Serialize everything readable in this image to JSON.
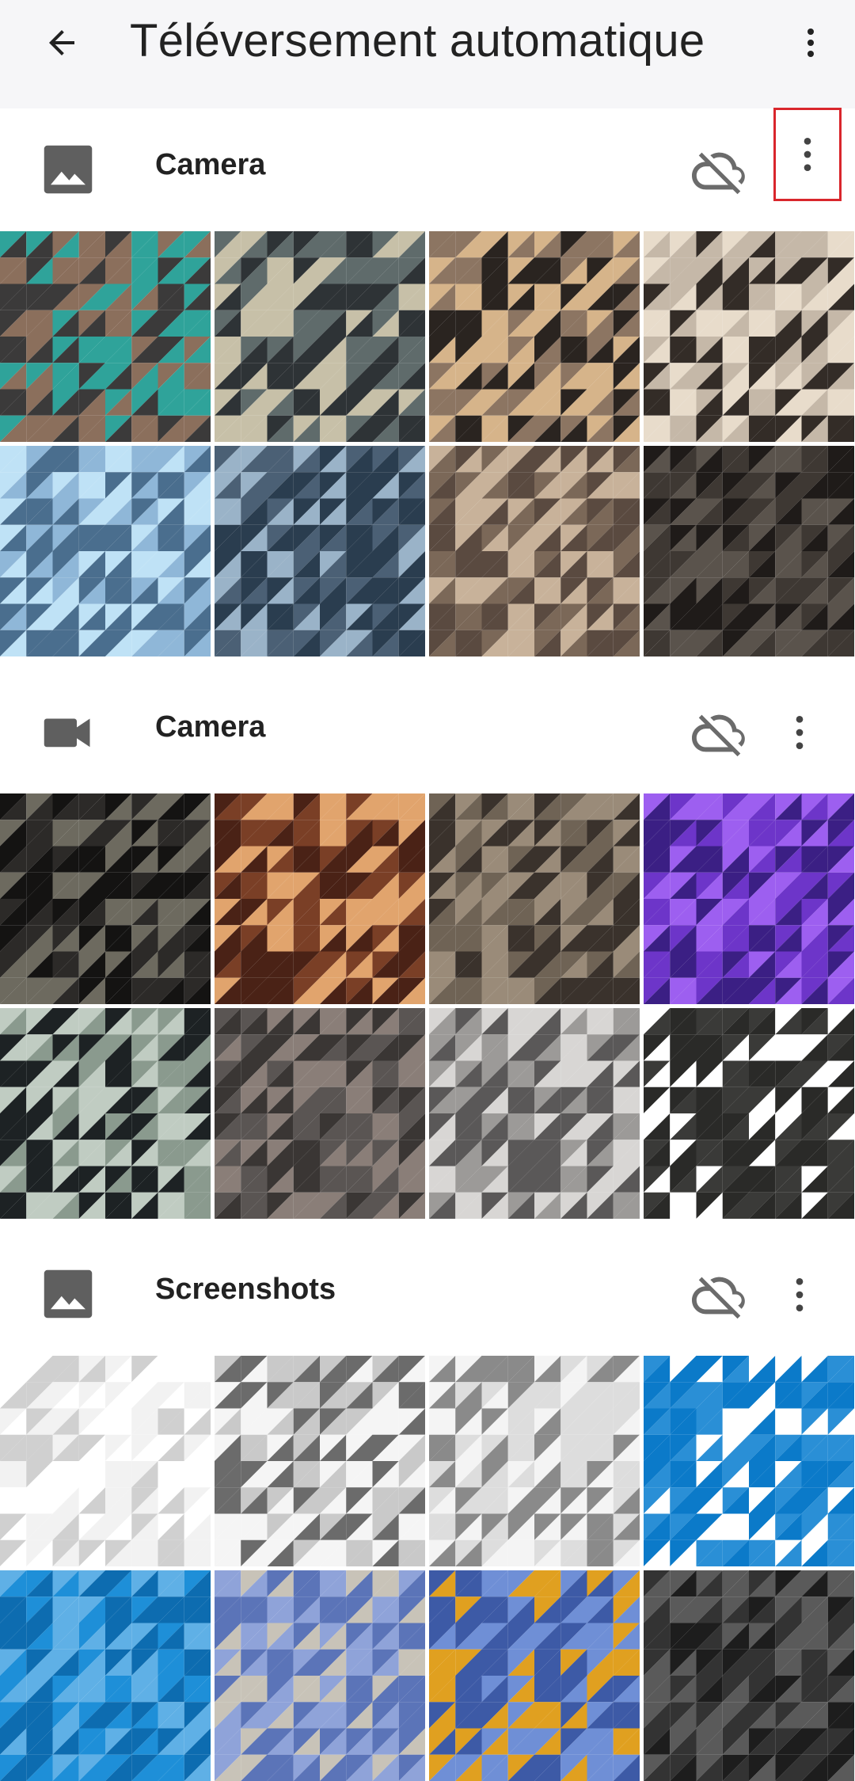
{
  "appbar": {
    "title": "Téléversement automatique",
    "back_icon": "arrow-back-icon",
    "more_icon": "more-vert-icon"
  },
  "sections": [
    {
      "label": "Camera",
      "type_icon": "image-icon",
      "status_icon": "cloud-off-icon",
      "more_icon": "more-vert-icon",
      "highlighted": true,
      "tiles": [
        [
          "#8b6f5c",
          "#3b3a3a",
          "#2fa39a"
        ],
        [
          "#5f6b6b",
          "#c7c0a8",
          "#2e3336"
        ],
        [
          "#8c7562",
          "#d6b48a",
          "#2a2420"
        ],
        [
          "#c5b8a8",
          "#e8dccb",
          "#332c27"
        ],
        [
          "#8fb7d8",
          "#4a6e8e",
          "#bfe2f6"
        ],
        [
          "#4b6075",
          "#2a3d4f",
          "#9ab3c8"
        ],
        [
          "#5a4a40",
          "#c8b29a",
          "#7b6858"
        ],
        [
          "#3e3833",
          "#5a534c",
          "#1f1b19"
        ]
      ]
    },
    {
      "label": "Camera",
      "type_icon": "video-camera-icon",
      "status_icon": "cloud-off-icon",
      "more_icon": "more-vert-icon",
      "highlighted": false,
      "tiles": [
        [
          "#2c2a28",
          "#6d6a5f",
          "#141312"
        ],
        [
          "#7a3f26",
          "#e1a46d",
          "#4a2216"
        ],
        [
          "#6f6355",
          "#9a8b79",
          "#3a322c"
        ],
        [
          "#6d35c9",
          "#9d5ff0",
          "#3b1f84"
        ],
        [
          "#1d2224",
          "#8a9a8e",
          "#c0ccc2"
        ],
        [
          "#5a5553",
          "#3a3634",
          "#8a7e78"
        ],
        [
          "#9c9a98",
          "#d8d6d4",
          "#5a5858"
        ],
        [
          "#3a3a38",
          "#2a2a28",
          "#ffffff"
        ]
      ]
    },
    {
      "label": "Screenshots",
      "type_icon": "image-icon",
      "status_icon": "cloud-off-icon",
      "more_icon": "more-vert-icon",
      "highlighted": false,
      "tiles": [
        [
          "#f2f2f2",
          "#d0d0d0",
          "#ffffff"
        ],
        [
          "#f5f5f5",
          "#6b6b6b",
          "#c9c9c9"
        ],
        [
          "#f4f4f4",
          "#8a8a8a",
          "#dddddd"
        ],
        [
          "#0b7ac9",
          "#2a8fd6",
          "#ffffff"
        ],
        [
          "#1e8fd8",
          "#0d6cb0",
          "#5fb0e6"
        ],
        [
          "#8fa3d9",
          "#5b74b8",
          "#c8c3b8"
        ],
        [
          "#6f8fd6",
          "#3d5aa6",
          "#e0a020"
        ],
        [
          "#1d1d1d",
          "#333333",
          "#5a5a5a"
        ]
      ]
    }
  ]
}
